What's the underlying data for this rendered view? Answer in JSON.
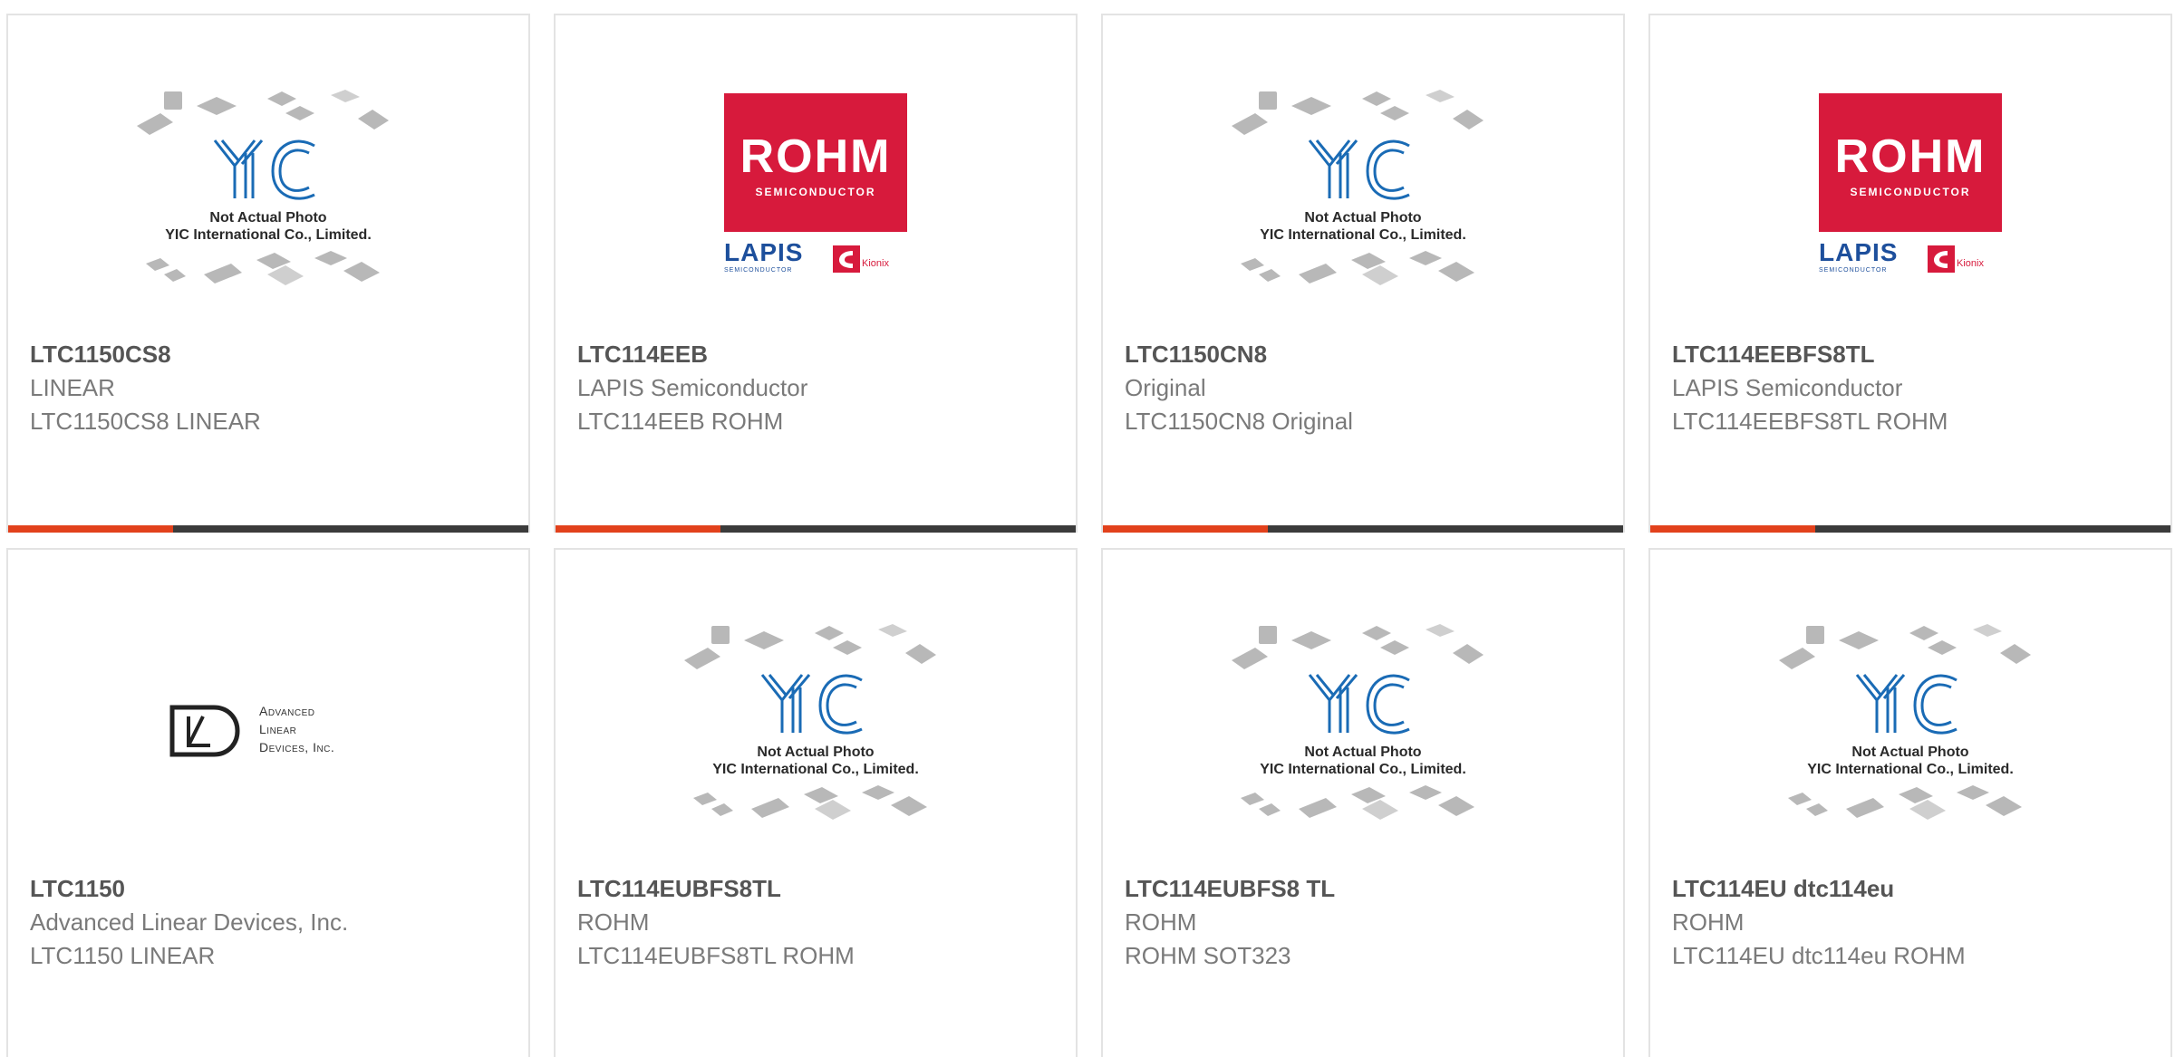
{
  "cards": [
    {
      "part": "LTC1150CS8",
      "manufacturer": "LINEAR",
      "description": "LTC1150CS8 LINEAR",
      "image": "yic-placeholder",
      "placeholder": {
        "line1": "Not Actual Photo",
        "line2": "YIC International Co., Limited.",
        "logo": "YIC"
      }
    },
    {
      "part": "LTC114EEB",
      "manufacturer": "LAPIS Semiconductor",
      "description": "LTC114EEB ROHM",
      "image": "rohm-logo",
      "logo": {
        "brand": "ROHM",
        "sub": "SEMICONDUCTOR",
        "brand2": "LAPIS",
        "sub2": "SEMICONDUCTOR",
        "brand3": "Kionix"
      }
    },
    {
      "part": "LTC1150CN8",
      "manufacturer": "Original",
      "description": "LTC1150CN8 Original",
      "image": "yic-placeholder",
      "placeholder": {
        "line1": "Not Actual Photo",
        "line2": "YIC International Co., Limited.",
        "logo": "YIC"
      }
    },
    {
      "part": "LTC114EEBFS8TL",
      "manufacturer": "LAPIS Semiconductor",
      "description": "LTC114EEBFS8TL ROHM",
      "image": "rohm-logo",
      "logo": {
        "brand": "ROHM",
        "sub": "SEMICONDUCTOR",
        "brand2": "LAPIS",
        "sub2": "SEMICONDUCTOR",
        "brand3": "Kionix"
      }
    },
    {
      "part": "LTC1150",
      "manufacturer": "Advanced Linear Devices, Inc.",
      "description": "LTC1150 LINEAR",
      "image": "adi-logo",
      "logo": {
        "line1": "Advanced",
        "line2": "Linear",
        "line3": "Devices, Inc."
      }
    },
    {
      "part": "LTC114EUBFS8TL",
      "manufacturer": "ROHM",
      "description": "LTC114EUBFS8TL ROHM",
      "image": "yic-placeholder",
      "placeholder": {
        "line1": "Not Actual Photo",
        "line2": "YIC International Co., Limited.",
        "logo": "YIC"
      }
    },
    {
      "part": "LTC114EUBFS8 TL",
      "manufacturer": "ROHM",
      "description": "ROHM SOT323",
      "image": "yic-placeholder",
      "placeholder": {
        "line1": "Not Actual Photo",
        "line2": "YIC International Co., Limited.",
        "logo": "YIC"
      }
    },
    {
      "part": "LTC114EU dtc114eu",
      "manufacturer": "ROHM",
      "description": "LTC114EU dtc114eu ROHM",
      "image": "yic-placeholder",
      "placeholder": {
        "line1": "Not Actual Photo",
        "line2": "YIC International Co., Limited.",
        "logo": "YIC"
      }
    }
  ],
  "colors": {
    "accent": "#e2411c",
    "bar": "#3b3b3b",
    "rohm_red": "#d71a3c",
    "yic_blue": "#1a6bb5"
  }
}
